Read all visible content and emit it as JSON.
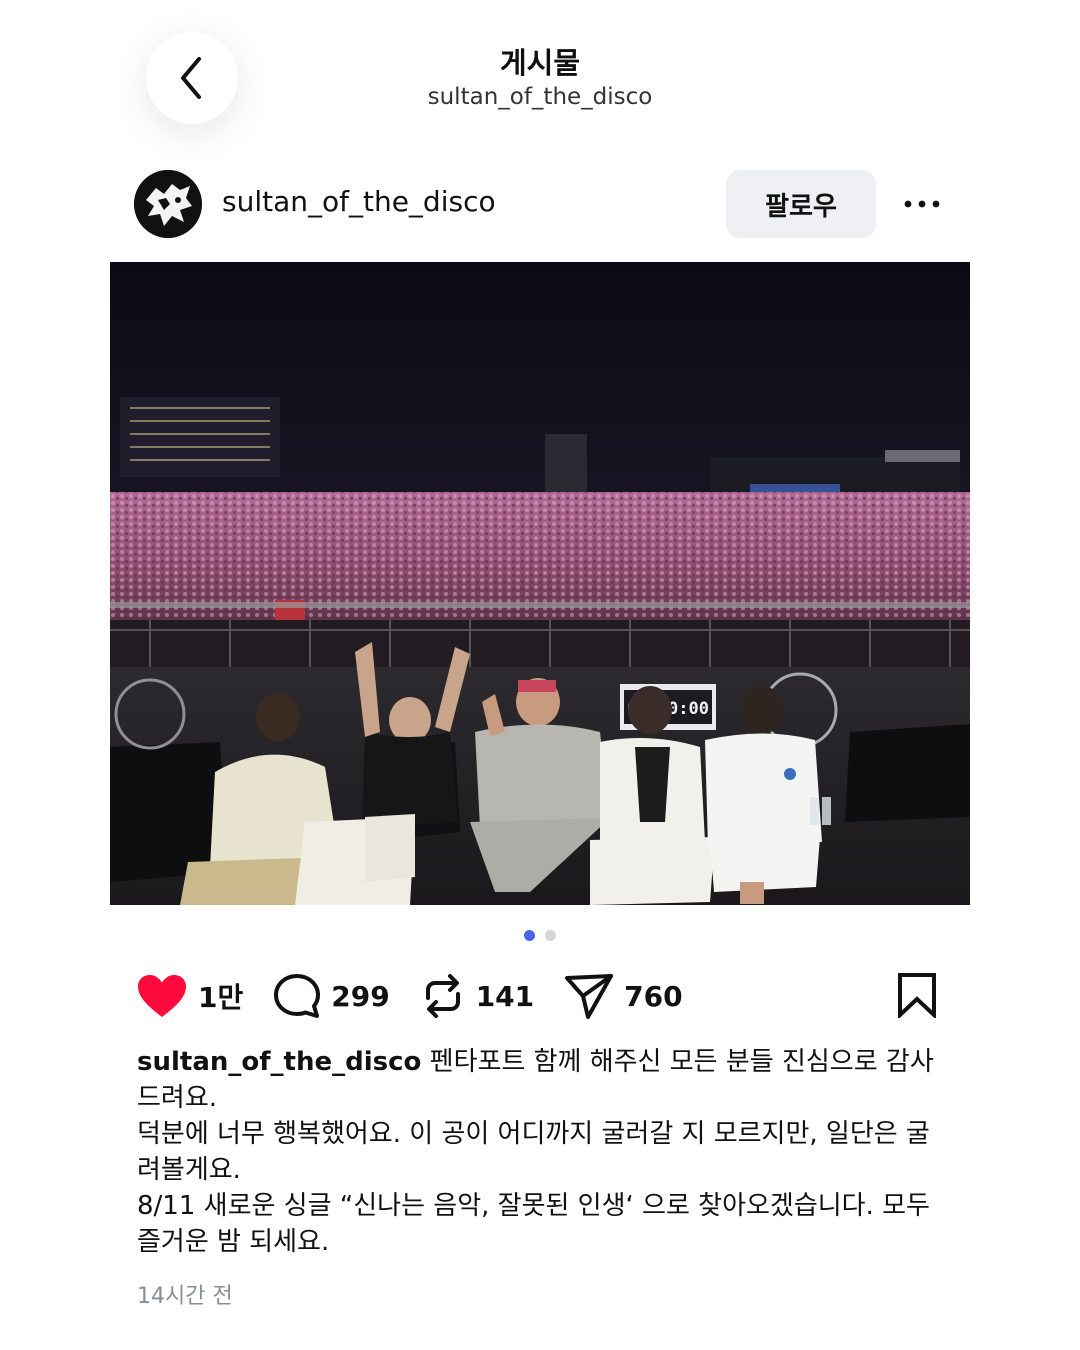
{
  "header": {
    "title": "게시물",
    "subtitle": "sultan_of_the_disco"
  },
  "post": {
    "username": "sultan_of_the_disco",
    "follow_label": "팔로우",
    "carousel_pages": 2,
    "carousel_current": 1
  },
  "actions": {
    "likes": "1만",
    "comments": "299",
    "reposts": "141",
    "shares": "760",
    "like_color": "#ff0a3c",
    "liked": true
  },
  "caption": {
    "username": "sultan_of_the_disco",
    "line1": "펜타포트 함께 해주신 모든 분들 진심으로 감사 드려요.",
    "line2": "덕분에 너무 행복했어요. 이 공이 어디까지 굴러갈 지 모르지만, 일단은 굴려볼게요.",
    "line3": "8/11 새로운 싱글 “신나는 음악, 잘못된 인생‘ 으로 찾아오겠습니다. 모두 즐거운 밤 되세요."
  },
  "timestamp": "14시간 전",
  "photo": {
    "scene_clock": "00:00:00"
  },
  "colors": {
    "accent_dot": "#4b63ea",
    "follow_bg": "#eef0f3"
  }
}
